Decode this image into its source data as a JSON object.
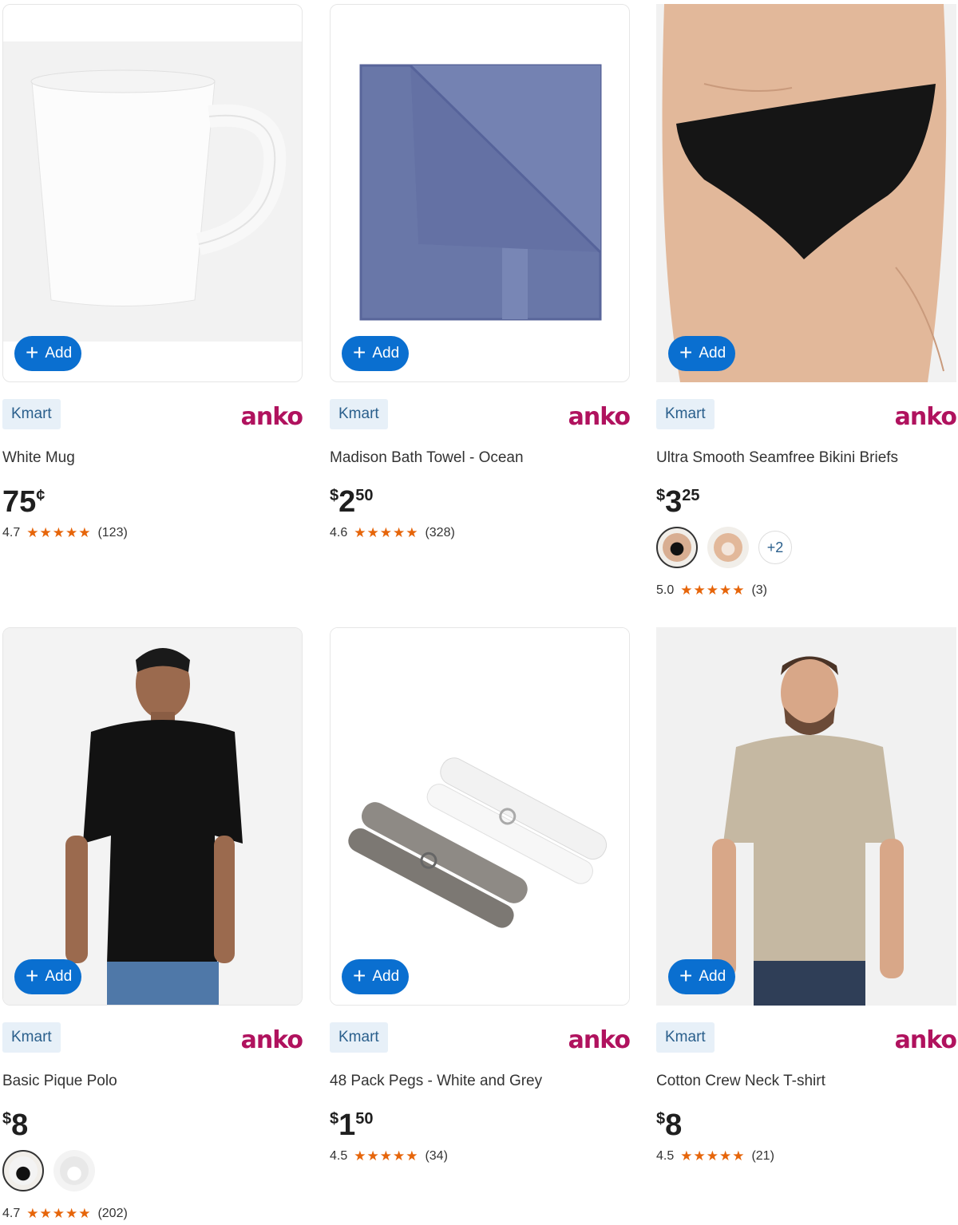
{
  "products": [
    {
      "store": "Kmart",
      "brand": "anko",
      "name": "White Mug",
      "price_cur": "",
      "price_main": "75",
      "price_cents": "¢",
      "rating": "4.7",
      "stars": "★★★★★",
      "reviews": "(123)",
      "add_label": "Add"
    },
    {
      "store": "Kmart",
      "brand": "anko",
      "name": "Madison Bath Towel - Ocean",
      "price_cur": "$",
      "price_main": "2",
      "price_cents": "50",
      "rating": "4.6",
      "stars": "★★★★★",
      "reviews": "(328)",
      "add_label": "Add"
    },
    {
      "store": "Kmart",
      "brand": "anko",
      "name": "Ultra Smooth Seamfree Bikini Briefs",
      "price_cur": "$",
      "price_main": "3",
      "price_cents": "25",
      "rating": "5.0",
      "stars": "★★★★★",
      "reviews": "(3)",
      "add_label": "Add",
      "more_swatches": "+2"
    },
    {
      "store": "Kmart",
      "brand": "anko",
      "name": "Basic Pique Polo",
      "price_cur": "$",
      "price_main": "8",
      "price_cents": "",
      "rating": "4.7",
      "stars": "★★★★★",
      "reviews": "(202)",
      "add_label": "Add"
    },
    {
      "store": "Kmart",
      "brand": "anko",
      "name": "48 Pack Pegs - White and Grey",
      "price_cur": "$",
      "price_main": "1",
      "price_cents": "50",
      "rating": "4.5",
      "stars": "★★★★★",
      "reviews": "(34)",
      "add_label": "Add"
    },
    {
      "store": "Kmart",
      "brand": "anko",
      "name": "Cotton Crew Neck T-shirt",
      "price_cur": "$",
      "price_main": "8",
      "price_cents": "",
      "rating": "4.5",
      "stars": "★★★★★",
      "reviews": "(21)",
      "add_label": "Add"
    }
  ],
  "colors": {
    "accent": "#0a6fd0",
    "brand": "#b0125e",
    "star": "#e6650a",
    "tag_bg": "#e7f0f8"
  }
}
